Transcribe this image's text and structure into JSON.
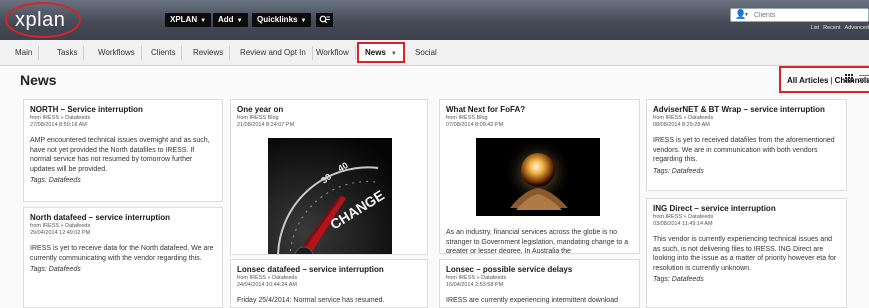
{
  "header": {
    "logo": "xplan",
    "menus": [
      {
        "label": "XPLAN"
      },
      {
        "label": "Add"
      },
      {
        "label": "Quicklinks"
      }
    ],
    "client_search": {
      "placeholder": "Clients",
      "links": [
        "List",
        "Recent",
        "Advanced"
      ]
    }
  },
  "tabs": [
    {
      "label": "Main"
    },
    {
      "label": "Tasks"
    },
    {
      "label": "Workflows"
    },
    {
      "label": "Clients"
    },
    {
      "label": "Reviews"
    },
    {
      "label": "Review and Opt In"
    },
    {
      "label": "Workflow"
    },
    {
      "label": "News",
      "active": true
    },
    {
      "label": "Social"
    }
  ],
  "page": {
    "title": "News",
    "view_links": {
      "all": "All Articles",
      "sep": "|",
      "channels": "Channels"
    }
  },
  "articles": [
    {
      "title": "NORTH – Service interruption",
      "source": "from IRESS » Datafeeds",
      "date": "27/08/2014 8:59:18 AM",
      "body": "AMP encountered technical issues overnight and as such, have not yet provided the North  datafiles to IRESS.  If normal service has not resumed by tomorrow further updates will be provided.",
      "tags": "Tags: Datafeeds"
    },
    {
      "title": "North datafeed – service interruption",
      "source": "from IRESS » Datafeeds",
      "date": "29/04/2014 12:49:02 PM",
      "body": "IRESS is yet to receive data for the North datafeed.  We are currently communicating with the vendor regarding this.",
      "tags": "Tags: Datafeeds"
    },
    {
      "title": "One year on",
      "source": "from IRESS Blog",
      "date": "21/08/2014 8:24:07 PM",
      "image_text": "CHANGE"
    },
    {
      "title": "Lonsec datafeed – service interruption",
      "source": "from IRESS » Datafeeds",
      "date": "24/04/2014 10:44:24 AM",
      "body": "Friday 25/4/2014: Normal service has resumed."
    },
    {
      "title": "What Next for FoFA?",
      "source": "from IRESS Blog",
      "date": "07/08/2014 8:09:42 PM",
      "body": "As an industry, financial services across the globe is no stranger to Government legislation, mandating change to a greater or lesser degree. In Australia the"
    },
    {
      "title": "Lonsec – possible service delays",
      "source": "from IRESS » Datafeeds",
      "date": "16/04/2014 2:53:58 PM",
      "body": "IRESS are currently experiencing intermittent download"
    },
    {
      "title": "AdviserNET & BT Wrap – service interruption",
      "source": "from IRESS » Datafeeds",
      "date": "08/08/2014 8:29:28 AM",
      "body": "IRESS is yet to received datafiles from the aforementioned vendors.  We are in communication with both vendors regarding this.",
      "tags": "Tags: Datafeeds"
    },
    {
      "title": "ING Direct – service interruption",
      "source": "from IRESS » Datafeeds",
      "date": "03/08/2014 11:49:14 AM",
      "body": "This vendor is currently experiencing technical issues and as such, is not delivering files to IRESS.  ING Direct are looking into the issue as a matter of priority however eta for resolution is currently unknown.",
      "tags": "Tags: Datafeeds"
    }
  ],
  "colors": {
    "highlight": "#d8232a",
    "header_bg": "#454b57",
    "tab_bg": "#f1f1f1"
  }
}
